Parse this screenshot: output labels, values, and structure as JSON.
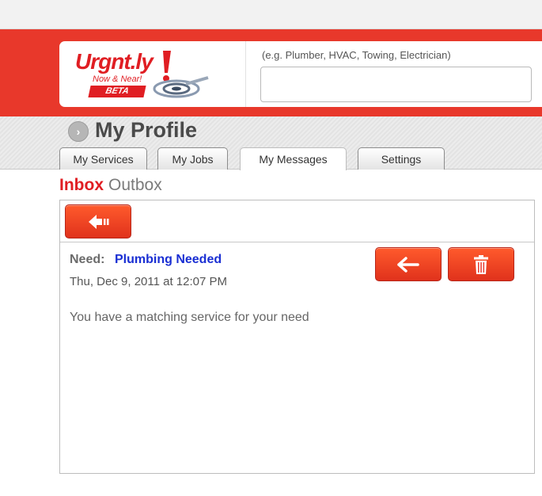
{
  "header": {
    "logo_text": "Urgnt.ly",
    "logo_tagline": "Now & Near!",
    "logo_badge": "BETA",
    "search_hint": "(e.g. Plumber, HVAC, Towing, Electrician)",
    "search_value": ""
  },
  "profile": {
    "title": "My Profile",
    "tabs": [
      {
        "label": "My Services",
        "active": false
      },
      {
        "label": "My Jobs",
        "active": false
      },
      {
        "label": "My Messages",
        "active": true
      },
      {
        "label": "Settings",
        "active": false
      }
    ]
  },
  "mailbox": {
    "inbox_label": "Inbox",
    "outbox_label": "Outbox"
  },
  "message": {
    "need_label": "Need:",
    "need_value": "Plumbing Needed",
    "date": "Thu, Dec 9, 2011 at 12:07 PM",
    "body": "You have a matching service for your need"
  },
  "icons": {
    "back": "back-arrow-icon",
    "reply": "reply-arrow-icon",
    "delete": "trash-icon",
    "profile": "chevron-right-circle-icon"
  },
  "colors": {
    "brand_red": "#e8382b",
    "logo_red": "#e01e23",
    "link_blue": "#1a2fd3",
    "button_red": "#ff5a2c"
  }
}
